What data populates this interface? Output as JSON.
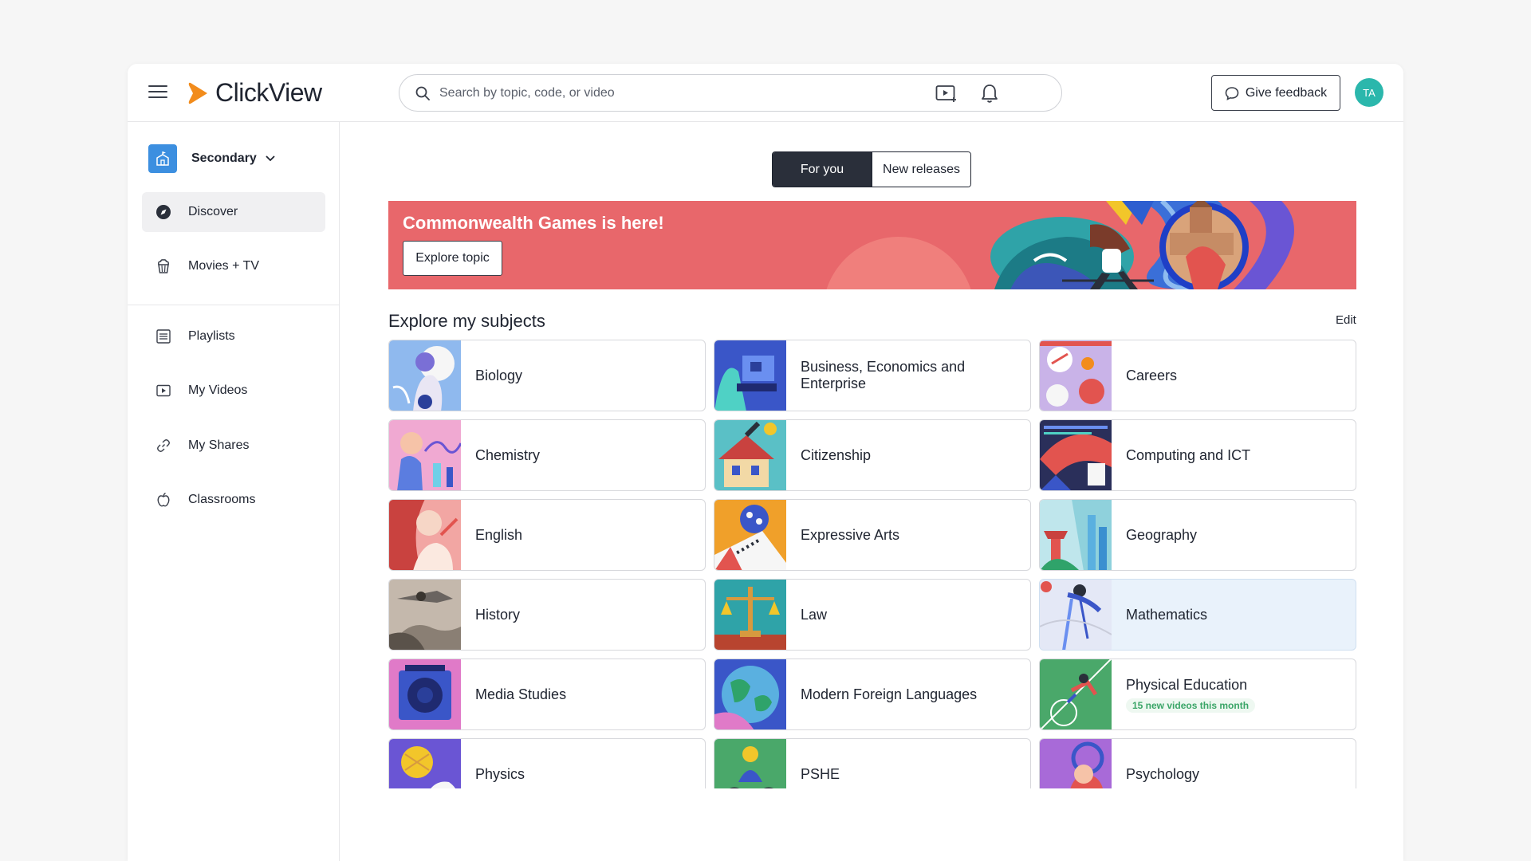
{
  "header": {
    "brand": "ClickView",
    "search_placeholder": "Search by topic, code, or video",
    "feedback_label": "Give feedback",
    "avatar_initials": "TA"
  },
  "sidebar": {
    "school": "Secondary",
    "items": [
      {
        "label": "Discover",
        "icon": "compass-icon",
        "active": true
      },
      {
        "label": "Movies + TV",
        "icon": "popcorn-icon"
      },
      {
        "label": "Playlists",
        "icon": "list-icon"
      },
      {
        "label": "My Videos",
        "icon": "video-icon"
      },
      {
        "label": "My Shares",
        "icon": "link-icon"
      },
      {
        "label": "Classrooms",
        "icon": "apple-icon"
      }
    ]
  },
  "tabs": {
    "for_you": "For you",
    "new_releases": "New releases"
  },
  "banner": {
    "title": "Commonwealth Games is here!",
    "button": "Explore topic",
    "color": "#e8676b"
  },
  "subjects": {
    "title": "Explore my subjects",
    "edit": "Edit",
    "cards": [
      {
        "label": "Biology"
      },
      {
        "label": "Business, Economics and Enterprise"
      },
      {
        "label": "Careers"
      },
      {
        "label": "Chemistry"
      },
      {
        "label": "Citizenship"
      },
      {
        "label": "Computing and ICT"
      },
      {
        "label": "English"
      },
      {
        "label": "Expressive Arts"
      },
      {
        "label": "Geography"
      },
      {
        "label": "History"
      },
      {
        "label": "Law"
      },
      {
        "label": "Mathematics"
      },
      {
        "label": "Media Studies"
      },
      {
        "label": "Modern Foreign Languages"
      },
      {
        "label": "Physical Education",
        "badge": "15 new videos this month"
      },
      {
        "label": "Physics"
      },
      {
        "label": "PSHE"
      },
      {
        "label": "Psychology"
      }
    ]
  },
  "colors": {
    "accent": "#f28c1c",
    "active_tab": "#2a2f3a",
    "avatar": "#2bb7ac",
    "school_icon": "#3c8fe0"
  }
}
